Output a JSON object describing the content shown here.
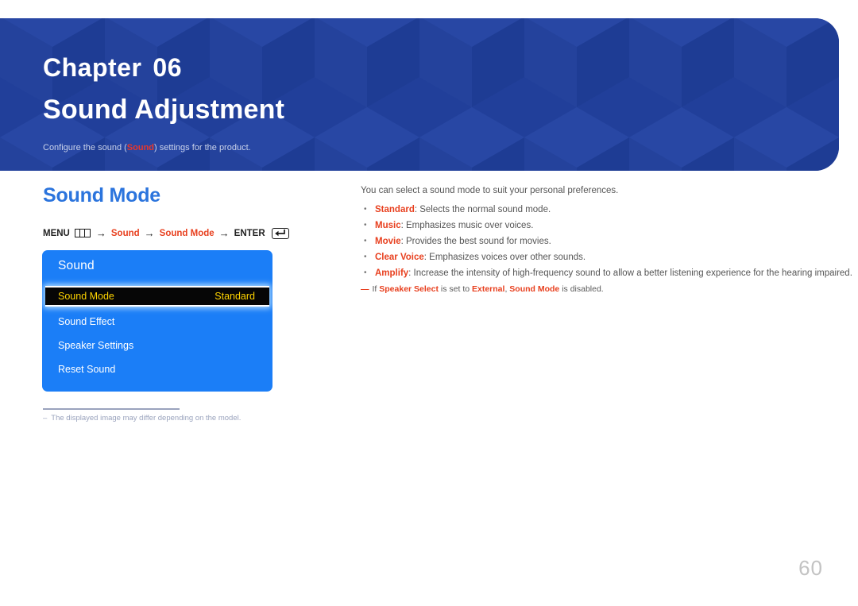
{
  "banner": {
    "chapter_word": "Chapter",
    "chapter_number": "06",
    "title": "Sound Adjustment",
    "subtitle_before": "Configure the sound (",
    "subtitle_highlight": "Sound",
    "subtitle_after": ") settings for the product.",
    "bg_color": "#21409a",
    "title_color": "#ffffff",
    "highlight_color": "#e8372a"
  },
  "section": {
    "heading": "Sound Mode",
    "heading_color": "#2b74dd"
  },
  "menu_path": {
    "menu_label": "MENU",
    "menu_icon": "menu-bars-icon",
    "arrow": "→",
    "step1": "Sound",
    "step2": "Sound Mode",
    "enter_label": "ENTER",
    "enter_icon": "enter-return-icon",
    "red_color": "#e8401f"
  },
  "osd": {
    "title": "Sound",
    "panel_color": "#1b7ef7",
    "selected_bg": "#060606",
    "selected_text_color": "#ffd400",
    "rows": [
      {
        "label": "Sound Mode",
        "value": "Standard",
        "selected": true
      },
      {
        "label": "Sound Effect",
        "value": "",
        "selected": false
      },
      {
        "label": "Speaker Settings",
        "value": "",
        "selected": false
      },
      {
        "label": "Reset Sound",
        "value": "",
        "selected": false
      }
    ]
  },
  "left_note": {
    "dash": "–",
    "text": "The displayed image may differ depending on the model."
  },
  "right": {
    "intro": "You can select a sound mode to suit your personal preferences.",
    "bullets": [
      {
        "term": "Standard",
        "desc": ": Selects the normal sound mode."
      },
      {
        "term": "Music",
        "desc": ": Emphasizes music over voices."
      },
      {
        "term": "Movie",
        "desc": ": Provides the best sound for movies."
      },
      {
        "term": "Clear Voice",
        "desc": ": Emphasizes voices over other sounds."
      },
      {
        "term": "Amplify",
        "desc": ": Increase the intensity of high-frequency sound to allow a better listening experience for the hearing impaired."
      }
    ],
    "tip": {
      "dash": "—",
      "p1": "If ",
      "t1": "Speaker Select",
      "p2": " is set to ",
      "t2": "External",
      "p3": ", ",
      "t3": "Sound Mode",
      "p4": " is disabled."
    }
  },
  "page_number": "60"
}
